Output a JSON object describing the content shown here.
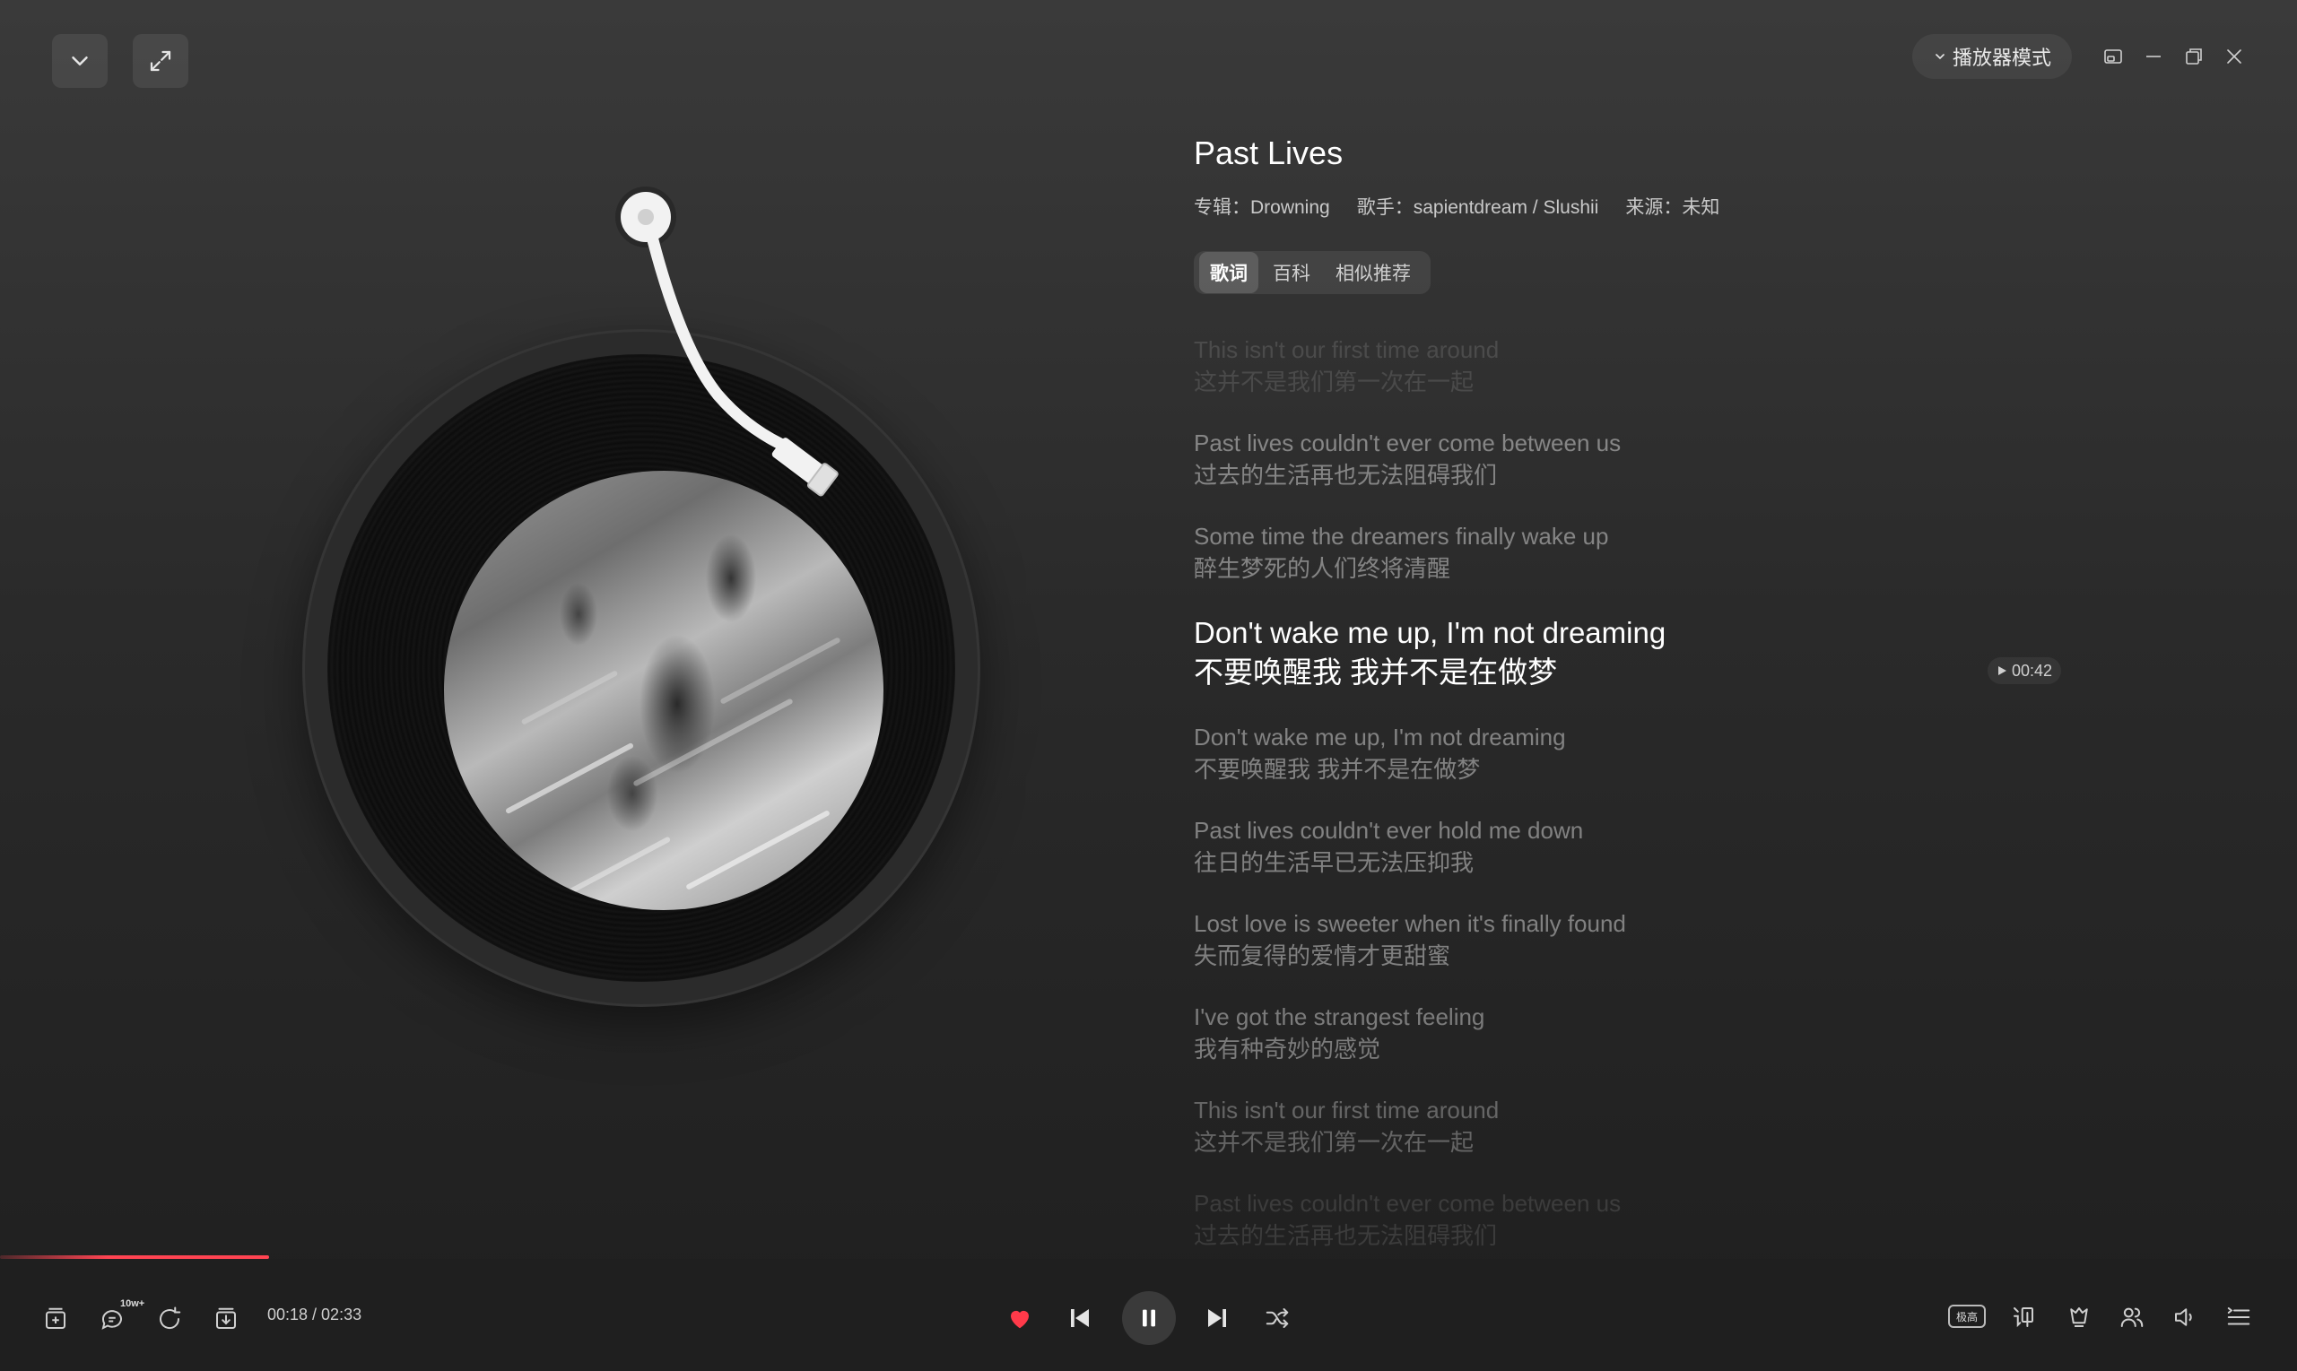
{
  "window": {
    "mode_label": "播放器模式"
  },
  "song": {
    "title": "Past Lives",
    "album": "专辑：Drowning",
    "artist": "歌手：sapientdream / Slushii",
    "source": "来源：未知"
  },
  "tabs": [
    {
      "label": "歌词",
      "active": true
    },
    {
      "label": "百科",
      "active": false
    },
    {
      "label": "相似推荐",
      "active": false
    }
  ],
  "lyrics": [
    {
      "en": "This isn't our first time around",
      "zh": "这并不是我们第一次在一起",
      "state": "faded"
    },
    {
      "en": "Past lives couldn't ever come between us",
      "zh": "过去的生活再也无法阻碍我们",
      "state": "normal"
    },
    {
      "en": "Some time the dreamers finally wake up",
      "zh": "醉生梦死的人们终将清醒",
      "state": "normal"
    },
    {
      "en": "Don't wake me up, I'm not dreaming",
      "zh": "不要唤醒我 我并不是在做梦",
      "state": "active"
    },
    {
      "en": "Don't wake me up, I'm not dreaming",
      "zh": "不要唤醒我 我并不是在做梦",
      "state": "normal"
    },
    {
      "en": "Past lives couldn't ever hold me down",
      "zh": "往日的生活早已无法压抑我",
      "state": "normal"
    },
    {
      "en": "Lost love is sweeter when it's finally found",
      "zh": "失而复得的爱情才更甜蜜",
      "state": "normal"
    },
    {
      "en": "I've got the strangest feeling",
      "zh": "我有种奇妙的感觉",
      "state": "normal"
    },
    {
      "en": "This isn't our first time around",
      "zh": "这并不是我们第一次在一起",
      "state": "dim"
    },
    {
      "en": "Past lives couldn't ever come between us",
      "zh": "过去的生活再也无法阻碍我们",
      "state": "faded"
    }
  ],
  "lyric_time_chip": "00:42",
  "player": {
    "current_time": "00:18",
    "total_time": "02:33",
    "time_display": "00:18 / 02:33",
    "progress": 0.117,
    "comment_badge": "10w+",
    "quality_label": "极高",
    "liked": true,
    "playing": true,
    "accent_color": "#ff4452"
  },
  "icons": {
    "top_left": [
      "chevron-down-icon",
      "expand-icon"
    ],
    "window": [
      "mini-player-icon",
      "minimize-icon",
      "maximize-icon",
      "close-icon"
    ],
    "bottom_left": [
      "add-to-playlist-icon",
      "comment-icon",
      "share-icon",
      "download-icon"
    ],
    "center": [
      "heart-icon",
      "previous-icon",
      "pause-icon",
      "next-icon",
      "shuffle-icon"
    ],
    "bottom_right": [
      "quality-icon",
      "lyrics-icon",
      "effects-icon",
      "listen-together-icon",
      "volume-icon",
      "playlist-icon"
    ]
  }
}
